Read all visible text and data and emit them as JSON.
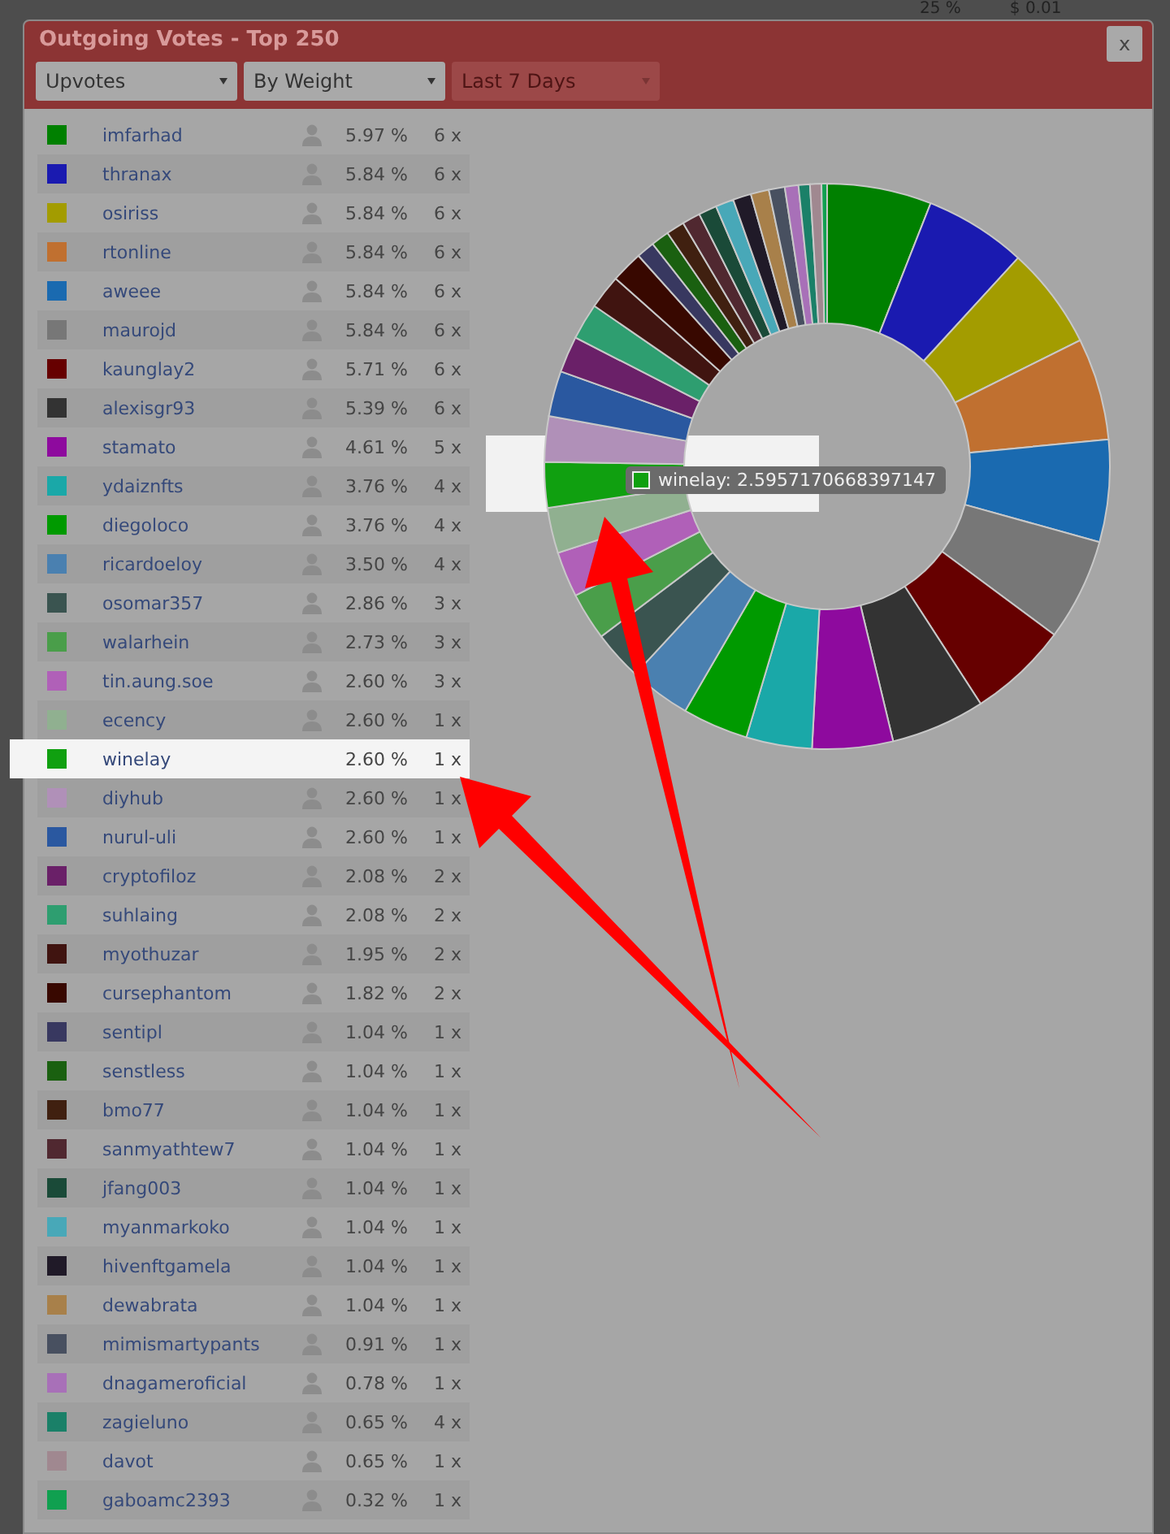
{
  "background": {
    "texts": [
      "25 %",
      "$ 0.01"
    ]
  },
  "dialog": {
    "title": "Outgoing Votes - Top 250",
    "close_label": "x",
    "filters": [
      {
        "label": "Upvotes",
        "disabled": false
      },
      {
        "label": "By Weight",
        "disabled": false
      },
      {
        "label": "Last 7 Days",
        "disabled": true
      }
    ]
  },
  "rows": [
    {
      "name": "imfarhad",
      "color": "#008000",
      "percent": "5.97 %",
      "count": "6 x",
      "selected": false
    },
    {
      "name": "thranax",
      "color": "#1a1ab0",
      "percent": "5.84 %",
      "count": "6 x",
      "selected": false
    },
    {
      "name": "osiriss",
      "color": "#a39c00",
      "percent": "5.84 %",
      "count": "6 x",
      "selected": false
    },
    {
      "name": "rtonline",
      "color": "#c07030",
      "percent": "5.84 %",
      "count": "6 x",
      "selected": false
    },
    {
      "name": "aweee",
      "color": "#1a6ab0",
      "percent": "5.84 %",
      "count": "6 x",
      "selected": false
    },
    {
      "name": "maurojd",
      "color": "#777777",
      "percent": "5.84 %",
      "count": "6 x",
      "selected": false
    },
    {
      "name": "kaunglay2",
      "color": "#660000",
      "percent": "5.71 %",
      "count": "6 x",
      "selected": false
    },
    {
      "name": "alexisgr93",
      "color": "#333333",
      "percent": "5.39 %",
      "count": "6 x",
      "selected": false
    },
    {
      "name": "stamato",
      "color": "#8e0a9e",
      "percent": "4.61 %",
      "count": "5 x",
      "selected": false
    },
    {
      "name": "ydaiznfts",
      "color": "#1aa8a8",
      "percent": "3.76 %",
      "count": "4 x",
      "selected": false
    },
    {
      "name": "diegoloco",
      "color": "#009a00",
      "percent": "3.76 %",
      "count": "4 x",
      "selected": false
    },
    {
      "name": "ricardoeloy",
      "color": "#4a80b0",
      "percent": "3.50 %",
      "count": "4 x",
      "selected": false
    },
    {
      "name": "osomar357",
      "color": "#3a5450",
      "percent": "2.86 %",
      "count": "3 x",
      "selected": false
    },
    {
      "name": "walarhein",
      "color": "#4a9e4a",
      "percent": "2.73 %",
      "count": "3 x",
      "selected": false
    },
    {
      "name": "tin.aung.soe",
      "color": "#b060b8",
      "percent": "2.60 %",
      "count": "3 x",
      "selected": false
    },
    {
      "name": "ecency",
      "color": "#90b090",
      "percent": "2.60 %",
      "count": "1 x",
      "selected": false
    },
    {
      "name": "winelay",
      "color": "#10a010",
      "percent": "2.60 %",
      "count": "1 x",
      "selected": true
    },
    {
      "name": "diyhub",
      "color": "#b090b8",
      "percent": "2.60 %",
      "count": "1 x",
      "selected": false
    },
    {
      "name": "nurul-uli",
      "color": "#2a58a0",
      "percent": "2.60 %",
      "count": "1 x",
      "selected": false
    },
    {
      "name": "cryptofiloz",
      "color": "#6a2068",
      "percent": "2.08 %",
      "count": "2 x",
      "selected": false
    },
    {
      "name": "suhlaing",
      "color": "#2e9e70",
      "percent": "2.08 %",
      "count": "2 x",
      "selected": false
    },
    {
      "name": "myothuzar",
      "color": "#401410",
      "percent": "1.95 %",
      "count": "2 x",
      "selected": false
    },
    {
      "name": "cursephantom",
      "color": "#380800",
      "percent": "1.82 %",
      "count": "2 x",
      "selected": false
    },
    {
      "name": "sentipl",
      "color": "#383860",
      "percent": "1.04 %",
      "count": "1 x",
      "selected": false
    },
    {
      "name": "senstless",
      "color": "#1a6010",
      "percent": "1.04 %",
      "count": "1 x",
      "selected": false
    },
    {
      "name": "bmo77",
      "color": "#402010",
      "percent": "1.04 %",
      "count": "1 x",
      "selected": false
    },
    {
      "name": "sanmyathtew7",
      "color": "#502830",
      "percent": "1.04 %",
      "count": "1 x",
      "selected": false
    },
    {
      "name": "jfang003",
      "color": "#1a4a38",
      "percent": "1.04 %",
      "count": "1 x",
      "selected": false
    },
    {
      "name": "myanmarkoko",
      "color": "#48a8b8",
      "percent": "1.04 %",
      "count": "1 x",
      "selected": false
    },
    {
      "name": "hivenftgamela",
      "color": "#201a28",
      "percent": "1.04 %",
      "count": "1 x",
      "selected": false
    },
    {
      "name": "dewabrata",
      "color": "#a8804a",
      "percent": "1.04 %",
      "count": "1 x",
      "selected": false
    },
    {
      "name": "mimismartypants",
      "color": "#485060",
      "percent": "0.91 %",
      "count": "1 x",
      "selected": false
    },
    {
      "name": "dnagameroficial",
      "color": "#a870b8",
      "percent": "0.78 %",
      "count": "1 x",
      "selected": false
    },
    {
      "name": "zagieluno",
      "color": "#1a8068",
      "percent": "0.65 %",
      "count": "4 x",
      "selected": false
    },
    {
      "name": "davot",
      "color": "#a08890",
      "percent": "0.65 %",
      "count": "1 x",
      "selected": false
    },
    {
      "name": "gaboamc2393",
      "color": "#10a050",
      "percent": "0.32 %",
      "count": "1 x",
      "selected": false
    }
  ],
  "chart": {
    "chart_data": {
      "type": "donut",
      "values": [
        5.97,
        5.84,
        5.84,
        5.84,
        5.84,
        5.84,
        5.71,
        5.39,
        4.61,
        3.76,
        3.76,
        3.5,
        2.86,
        2.73,
        2.6,
        2.6,
        2.6,
        2.6,
        2.6,
        2.08,
        2.08,
        1.95,
        1.82,
        1.04,
        1.04,
        1.04,
        1.04,
        1.04,
        1.04,
        1.04,
        1.04,
        0.91,
        0.78,
        0.65,
        0.65,
        0.32
      ]
    },
    "tooltip": "winelay: 2.5957170668397147"
  },
  "annotations": [
    {
      "kind": "chart-spotlight"
    },
    {
      "kind": "chart-arrow"
    },
    {
      "kind": "row-arrow"
    }
  ]
}
